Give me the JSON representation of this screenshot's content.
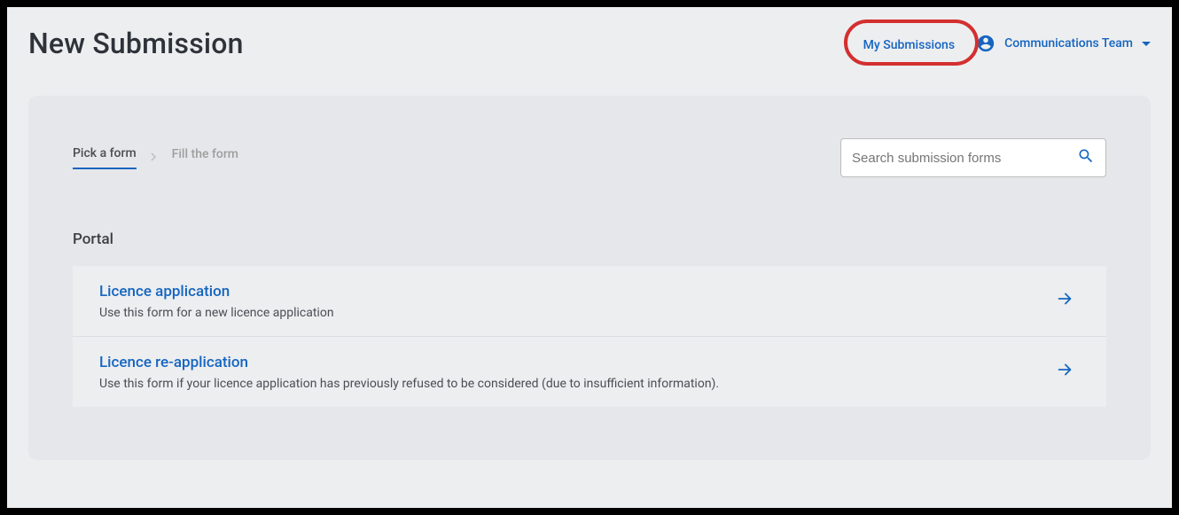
{
  "header": {
    "title": "New Submission",
    "my_submissions_label": "My Submissions",
    "user_name": "Communications Team"
  },
  "breadcrumb": {
    "step1": "Pick a form",
    "step2": "Fill the form"
  },
  "search": {
    "placeholder": "Search submission forms"
  },
  "section": {
    "title": "Portal"
  },
  "forms": [
    {
      "title": "Licence application",
      "description": "Use this form for a new licence application"
    },
    {
      "title": "Licence re-application",
      "description": "Use this form if your licence application has previously refused to be considered (due to insufficient information)."
    }
  ]
}
